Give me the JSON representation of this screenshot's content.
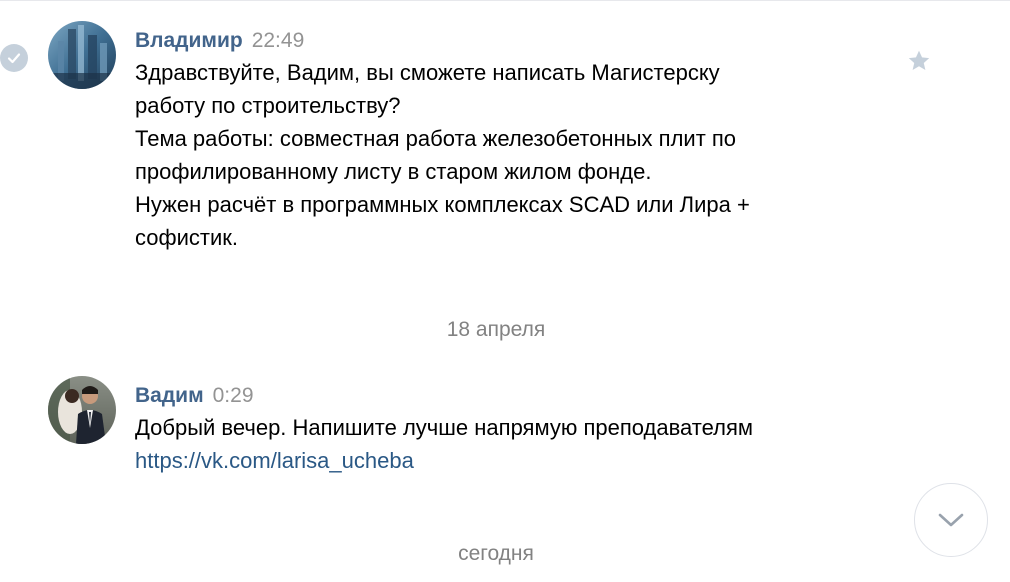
{
  "messages": [
    {
      "author": "Владимир",
      "time": "22:49",
      "lines": [
        "Здравствуйте, Вадим, вы сможете написать Магистерску",
        "работу по строительству?",
        "Тема работы: совместная работа железобетонных плит по",
        "профилированному листу в старом жилом фонде.",
        "Нужен расчёт в программных комплексах SCAD или Лира +",
        "софистик."
      ],
      "icons": {
        "selected": "check-icon",
        "favorite": "star-icon"
      }
    },
    {
      "author": "Вадим",
      "time": "0:29",
      "lines": [
        "Добрый вечер. Напишите лучше напрямую преподавателям"
      ],
      "link": "https://vk.com/larisa_ucheba"
    }
  ],
  "date_separators": [
    "18 апреля",
    "сегодня"
  ],
  "scroll_button": {
    "icon": "chevron-down-icon"
  },
  "colors": {
    "author": "#42648b",
    "time": "#939393",
    "link": "#2a5885",
    "separator": "#828282"
  }
}
